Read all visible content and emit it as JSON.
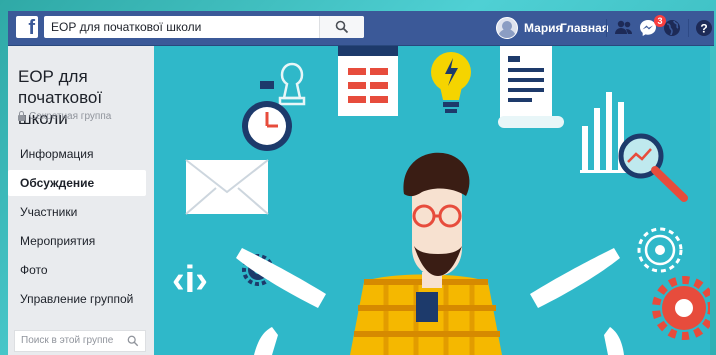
{
  "topbar": {
    "logo": "f",
    "search_value": "ЕОР для початкової школи",
    "user_name": "Мария",
    "home_label": "Главная",
    "notifications_count": "3",
    "icons": [
      "friends-icon",
      "messages-icon",
      "globe-icon",
      "help-icon"
    ]
  },
  "sidebar": {
    "group_title": "ЕОР для початкової школи",
    "privacy": "Секретная группа",
    "items": [
      {
        "label": "Информация",
        "active": false
      },
      {
        "label": "Обсуждение",
        "active": true
      },
      {
        "label": "Участники",
        "active": false
      },
      {
        "label": "Мероприятия",
        "active": false
      },
      {
        "label": "Фото",
        "active": false
      },
      {
        "label": "Управление группой",
        "active": false
      }
    ],
    "search_placeholder": "Поиск в этой группе"
  },
  "cover": {
    "info_symbol": "‹i›"
  },
  "colors": {
    "fb_blue": "#3b5998",
    "cover_bg": "#2fb8c9",
    "sidebar_bg": "#e9ebee"
  }
}
